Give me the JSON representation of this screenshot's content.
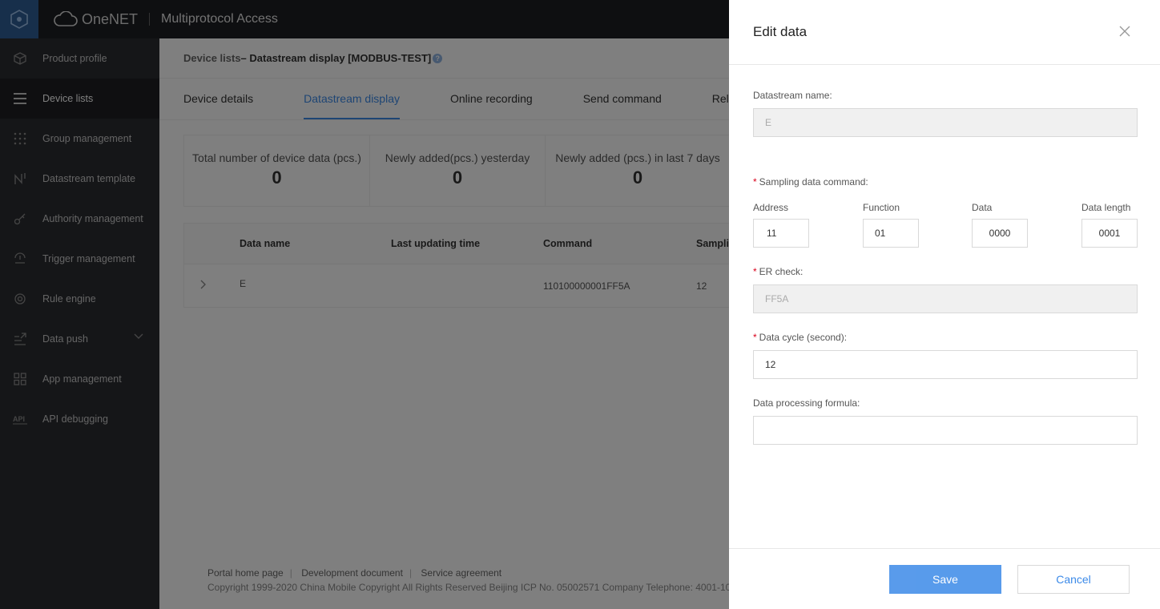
{
  "topbar": {
    "brand": "OneNET",
    "app_title": "Multiprotocol Access"
  },
  "sidebar": {
    "items": [
      {
        "label": "Product profile",
        "icon": "cube-icon"
      },
      {
        "label": "Device lists",
        "icon": "list-icon",
        "active": true
      },
      {
        "label": "Group management",
        "icon": "grid-dots-icon"
      },
      {
        "label": "Datastream template",
        "icon": "datastream-icon"
      },
      {
        "label": "Authority management",
        "icon": "key-icon"
      },
      {
        "label": "Trigger management",
        "icon": "trigger-icon"
      },
      {
        "label": "Rule engine",
        "icon": "rule-engine-icon"
      },
      {
        "label": "Data push",
        "icon": "data-push-icon"
      },
      {
        "label": "App management",
        "icon": "app-grid-icon"
      },
      {
        "label": "API debugging",
        "icon": "api-icon"
      }
    ]
  },
  "breadcrumb": {
    "link": "Device lists",
    "current": " – Datastream display [MODBUS-TEST]",
    "help": "?"
  },
  "tabs": [
    "Device details",
    "Datastream display",
    "Online recording",
    "Send command",
    "Rel"
  ],
  "stats": [
    {
      "label": "Total number of device data (pcs.)",
      "value": "0"
    },
    {
      "label": "Newly added(pcs.) yesterday",
      "value": "0"
    },
    {
      "label": "Newly added (pcs.) in last 7 days",
      "value": "0"
    }
  ],
  "table": {
    "headers": [
      "Data name",
      "Last updating time",
      "Command",
      "Sampli"
    ],
    "rows": [
      {
        "name": "E",
        "time": "",
        "command": "110100000001FF5A",
        "sampling": "12"
      }
    ]
  },
  "footer": {
    "links": [
      "Portal home page",
      "Development document",
      "Service agreement"
    ],
    "copyright": "Copyright 1999-2020 China Mobile Copyright All Rights Reserved Beijing ICP No. 05002571 Company Telephone: 4001-10"
  },
  "drawer": {
    "title": "Edit data",
    "datastream_label": "Datastream name:",
    "datastream_value": "E",
    "sampling_label": "Sampling data command:",
    "address_label": "Address",
    "function_label": "Function",
    "data_label": "Data",
    "length_label": "Data length",
    "address_value": "11",
    "function_value": "01",
    "data_value": "0000",
    "length_value": "0001",
    "er_label": "ER check:",
    "er_value": "FF5A",
    "cycle_label": "Data cycle (second):",
    "cycle_value": "12",
    "formula_label": "Data processing formula:",
    "formula_value": "",
    "save": "Save",
    "cancel": "Cancel",
    "required_mark": "*"
  },
  "colors": {
    "accent": "#3c8ae8",
    "topbar": "#1d1e22",
    "sidebar": "#2b2c31",
    "required": "#d9001b"
  }
}
